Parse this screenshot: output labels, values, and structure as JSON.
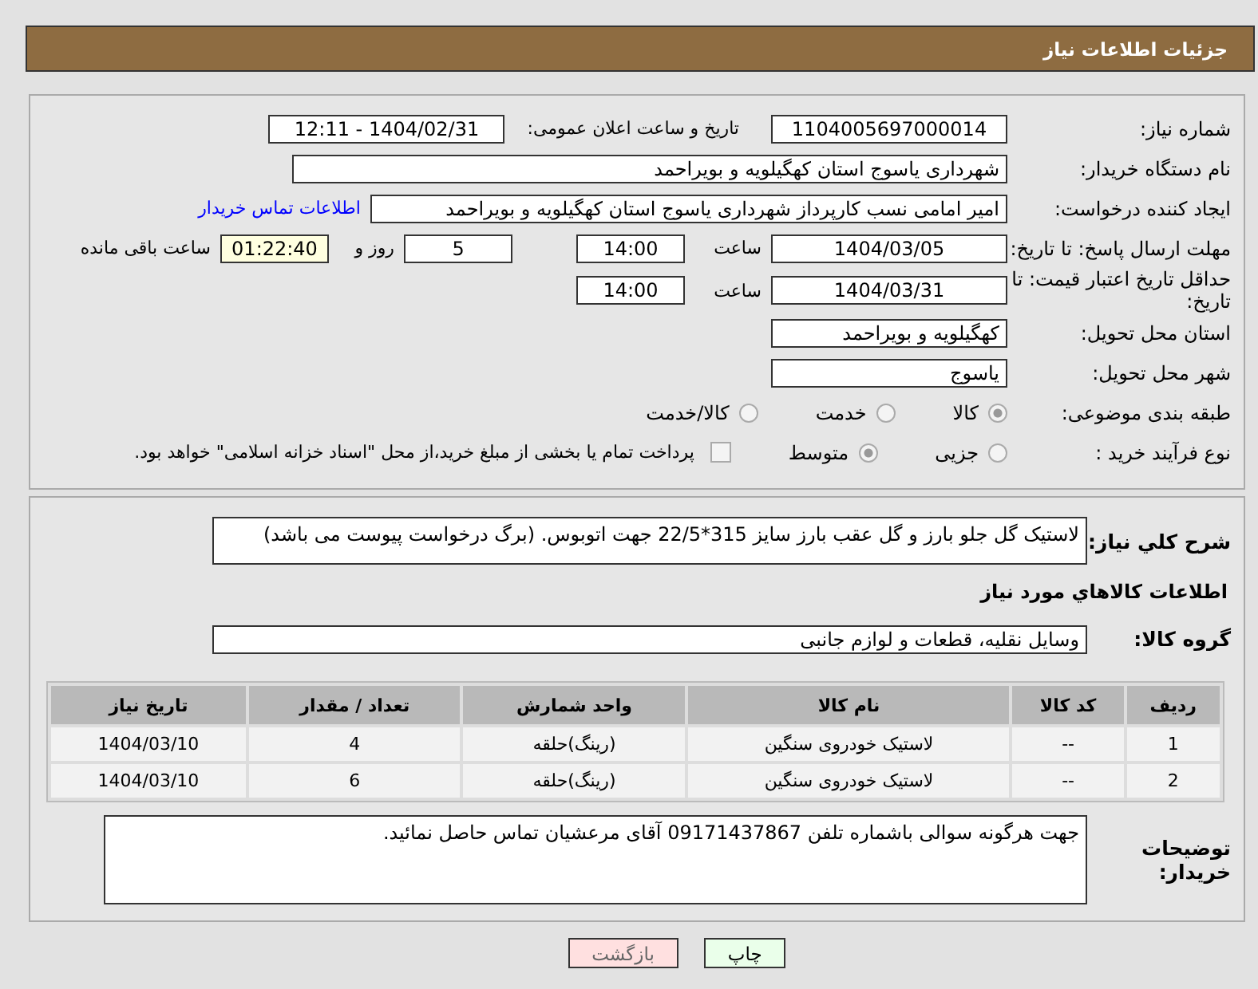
{
  "header": {
    "title": "جزئیات اطلاعات نیاز"
  },
  "details": {
    "need_number": {
      "label": "شماره نیاز:",
      "value": "1104005697000014"
    },
    "announce": {
      "label": "تاریخ و ساعت اعلان عمومی:",
      "value": "1404/02/31 - 12:11"
    },
    "buyer_org": {
      "label": "نام دستگاه خریدار:",
      "value": "شهرداری یاسوج استان کهگیلویه و بویراحمد"
    },
    "creator": {
      "label": "ایجاد کننده درخواست:",
      "value": "امیر امامی نسب کارپرداز شهرداری یاسوج استان کهگیلویه و بویراحمد",
      "link": "اطلاعات تماس خریدار"
    },
    "deadline": {
      "label": "مهلت ارسال پاسخ: تا تاریخ:",
      "date": "1404/03/05",
      "time_label": "ساعت",
      "time": "14:00",
      "days": "5",
      "days_label": "روز و",
      "remaining": "01:22:40",
      "remaining_label": "ساعت باقی مانده"
    },
    "validity": {
      "label": "حداقل تاریخ اعتبار قیمت: تا تاریخ:",
      "date": "1404/03/31",
      "time_label": "ساعت",
      "time": "14:00"
    },
    "province": {
      "label": "استان محل تحویل:",
      "value": "کهگیلویه و بویراحمد"
    },
    "city": {
      "label": "شهر محل تحویل:",
      "value": "یاسوج"
    },
    "category": {
      "label": "طبقه بندی موضوعی:",
      "options": [
        {
          "label": "کالا",
          "selected": true
        },
        {
          "label": "خدمت",
          "selected": false
        },
        {
          "label": "کالا/خدمت",
          "selected": false
        }
      ]
    },
    "process": {
      "label": "نوع فرآیند خرید :",
      "options": [
        {
          "label": "جزیی",
          "selected": false
        },
        {
          "label": "متوسط",
          "selected": true
        }
      ],
      "treasury": {
        "checked": false,
        "label": "پرداخت تمام یا بخشی از مبلغ خرید،از محل \"اسناد خزانه اسلامی\" خواهد بود."
      }
    }
  },
  "goods": {
    "description": {
      "label": "شرح کلي نياز:",
      "value": "لاستیک گل جلو بارز و گل عقب بارز سایز 315*22/5 جهت اتوبوس. (برگ درخواست پیوست می باشد)"
    },
    "heading": "اطلاعات کالاهاي مورد نياز",
    "group": {
      "label": "گروه کالا:",
      "value": "وسایل نقلیه، قطعات و لوازم جانبی"
    },
    "table": {
      "columns": [
        "ردیف",
        "کد کالا",
        "نام کالا",
        "واحد شمارش",
        "تعداد / مقدار",
        "تاریخ نیاز"
      ],
      "rows": [
        [
          "1",
          "--",
          "لاستیک خودروی سنگین",
          "(رینگ)حلقه",
          "4",
          "1404/03/10"
        ],
        [
          "2",
          "--",
          "لاستیک خودروی سنگین",
          "(رینگ)حلقه",
          "6",
          "1404/03/10"
        ]
      ]
    },
    "notes": {
      "label": "توضیحات خریدار:",
      "value": "جهت هرگونه سوالی باشماره تلفن 09171437867  آقای مرعشیان تماس حاصل نمائید."
    }
  },
  "buttons": [
    {
      "label": "چاپ",
      "kind": "print"
    },
    {
      "label": "بازگشت",
      "kind": "back"
    }
  ]
}
